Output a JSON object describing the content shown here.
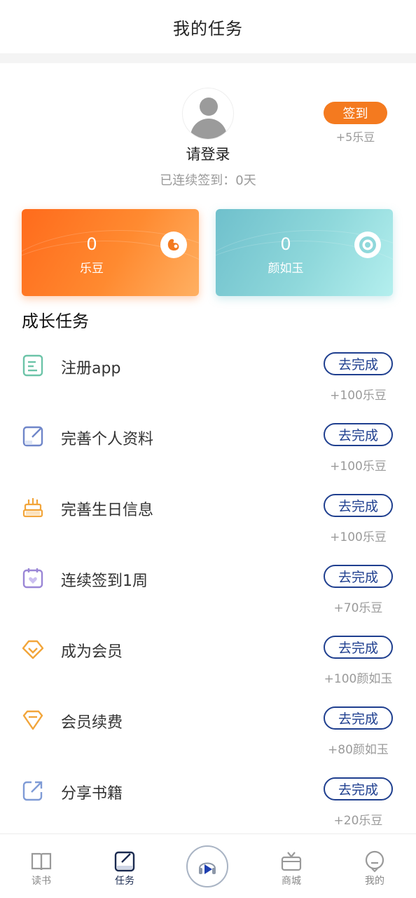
{
  "header": {
    "title": "我的任务"
  },
  "profile": {
    "login_text": "请登录",
    "streak_text": "已连续签到：0天",
    "checkin_label": "签到",
    "checkin_reward": "+5乐豆"
  },
  "cards": [
    {
      "value": "0",
      "label": "乐豆"
    },
    {
      "value": "0",
      "label": "颜如玉"
    }
  ],
  "section": {
    "title": "成长任务"
  },
  "tasks": [
    {
      "name": "注册app",
      "button": "去完成",
      "reward": "+100乐豆",
      "icon": "document-icon"
    },
    {
      "name": "完善个人资料",
      "button": "去完成",
      "reward": "+100乐豆",
      "icon": "edit-icon"
    },
    {
      "name": "完善生日信息",
      "button": "去完成",
      "reward": "+100乐豆",
      "icon": "cake-icon"
    },
    {
      "name": "连续签到1周",
      "button": "去完成",
      "reward": "+70乐豆",
      "icon": "calendar-icon"
    },
    {
      "name": "成为会员",
      "button": "去完成",
      "reward": "+100颜如玉",
      "icon": "diamond-icon"
    },
    {
      "name": "会员续费",
      "button": "去完成",
      "reward": "+80颜如玉",
      "icon": "gem-icon"
    },
    {
      "name": "分享书籍",
      "button": "去完成",
      "reward": "+20乐豆",
      "icon": "share-icon"
    }
  ],
  "nav": {
    "read": "读书",
    "tasks": "任务",
    "mall": "商城",
    "mine": "我的"
  },
  "colors": {
    "accent_orange": "#f47a1f",
    "button_blue": "#1f3f8f",
    "teal": "#8fd8db"
  }
}
